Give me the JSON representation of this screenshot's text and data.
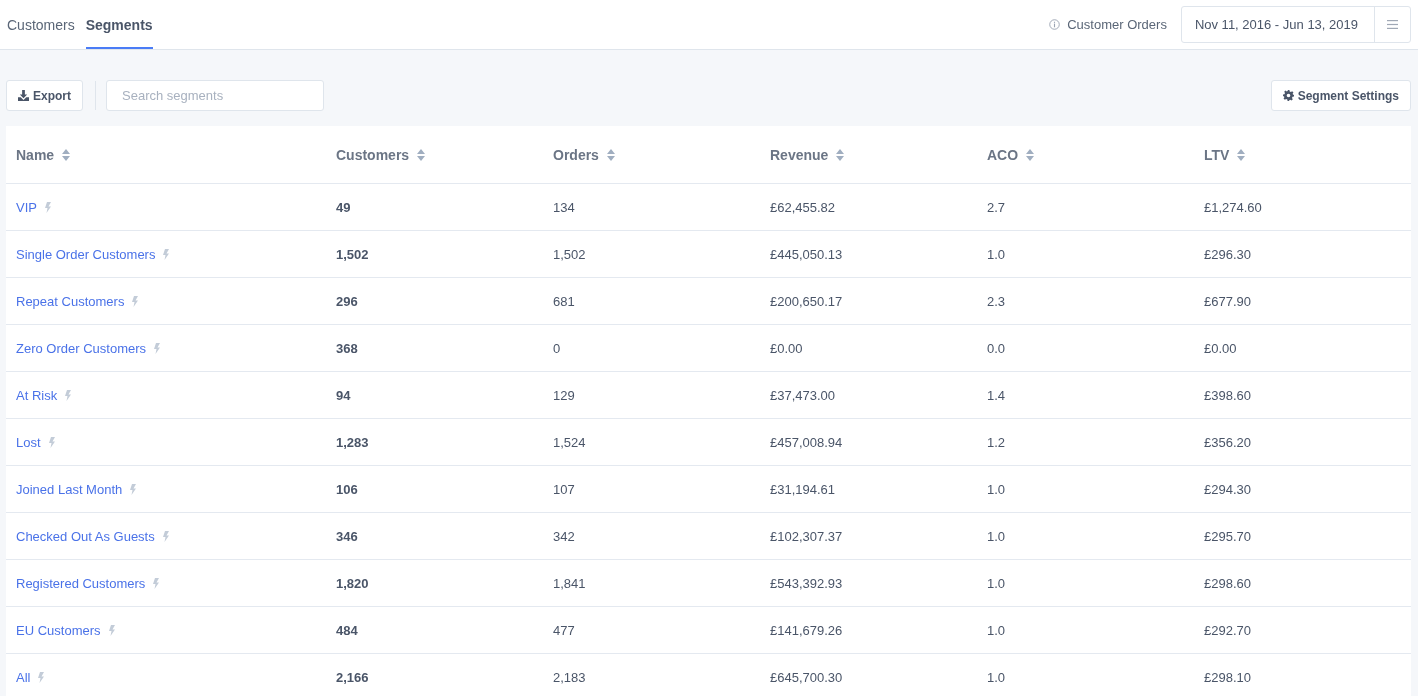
{
  "tabs": [
    {
      "label": "Customers",
      "selected": false
    },
    {
      "label": "Segments",
      "selected": true
    }
  ],
  "header": {
    "info_label": "Customer Orders",
    "date_range": "Nov 11, 2016 - Jun 13, 2019"
  },
  "toolbar": {
    "export_label": "Export",
    "search": {
      "placeholder": "Search segments"
    },
    "settings_label": "Segment Settings"
  },
  "table": {
    "columns": [
      "Name",
      "Customers",
      "Orders",
      "Revenue",
      "ACO",
      "LTV"
    ],
    "rows": [
      {
        "name": "VIP",
        "customers": "49",
        "orders": "134",
        "revenue": "£62,455.82",
        "aco": "2.7",
        "ltv": "£1,274.60"
      },
      {
        "name": "Single Order Customers",
        "customers": "1,502",
        "orders": "1,502",
        "revenue": "£445,050.13",
        "aco": "1.0",
        "ltv": "£296.30"
      },
      {
        "name": "Repeat Customers",
        "customers": "296",
        "orders": "681",
        "revenue": "£200,650.17",
        "aco": "2.3",
        "ltv": "£677.90"
      },
      {
        "name": "Zero Order Customers",
        "customers": "368",
        "orders": "0",
        "revenue": "£0.00",
        "aco": "0.0",
        "ltv": "£0.00"
      },
      {
        "name": "At Risk",
        "customers": "94",
        "orders": "129",
        "revenue": "£37,473.00",
        "aco": "1.4",
        "ltv": "£398.60"
      },
      {
        "name": "Lost",
        "customers": "1,283",
        "orders": "1,524",
        "revenue": "£457,008.94",
        "aco": "1.2",
        "ltv": "£356.20"
      },
      {
        "name": "Joined Last Month",
        "customers": "106",
        "orders": "107",
        "revenue": "£31,194.61",
        "aco": "1.0",
        "ltv": "£294.30"
      },
      {
        "name": "Checked Out As Guests",
        "customers": "346",
        "orders": "342",
        "revenue": "£102,307.37",
        "aco": "1.0",
        "ltv": "£295.70"
      },
      {
        "name": "Registered Customers",
        "customers": "1,820",
        "orders": "1,841",
        "revenue": "£543,392.93",
        "aco": "1.0",
        "ltv": "£298.60"
      },
      {
        "name": "EU Customers",
        "customers": "484",
        "orders": "477",
        "revenue": "£141,679.26",
        "aco": "1.0",
        "ltv": "£292.70"
      },
      {
        "name": "All",
        "customers": "2,166",
        "orders": "2,183",
        "revenue": "£645,700.30",
        "aco": "1.0",
        "ltv": "£298.10"
      }
    ]
  }
}
